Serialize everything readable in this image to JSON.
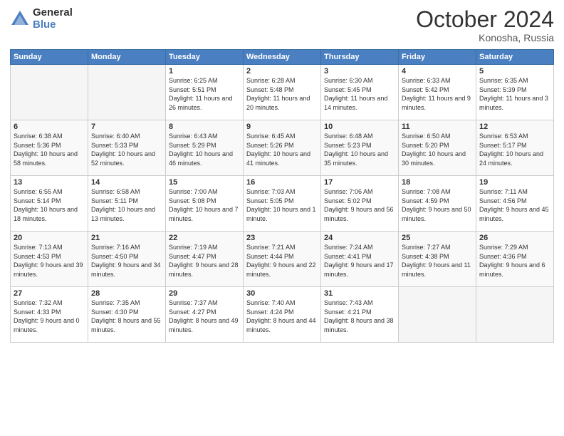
{
  "header": {
    "logo_general": "General",
    "logo_blue": "Blue",
    "month": "October 2024",
    "location": "Konosha, Russia"
  },
  "days_of_week": [
    "Sunday",
    "Monday",
    "Tuesday",
    "Wednesday",
    "Thursday",
    "Friday",
    "Saturday"
  ],
  "weeks": [
    [
      {
        "day": "",
        "info": ""
      },
      {
        "day": "",
        "info": ""
      },
      {
        "day": "1",
        "info": "Sunrise: 6:25 AM\nSunset: 5:51 PM\nDaylight: 11 hours and 26 minutes."
      },
      {
        "day": "2",
        "info": "Sunrise: 6:28 AM\nSunset: 5:48 PM\nDaylight: 11 hours and 20 minutes."
      },
      {
        "day": "3",
        "info": "Sunrise: 6:30 AM\nSunset: 5:45 PM\nDaylight: 11 hours and 14 minutes."
      },
      {
        "day": "4",
        "info": "Sunrise: 6:33 AM\nSunset: 5:42 PM\nDaylight: 11 hours and 9 minutes."
      },
      {
        "day": "5",
        "info": "Sunrise: 6:35 AM\nSunset: 5:39 PM\nDaylight: 11 hours and 3 minutes."
      }
    ],
    [
      {
        "day": "6",
        "info": "Sunrise: 6:38 AM\nSunset: 5:36 PM\nDaylight: 10 hours and 58 minutes."
      },
      {
        "day": "7",
        "info": "Sunrise: 6:40 AM\nSunset: 5:33 PM\nDaylight: 10 hours and 52 minutes."
      },
      {
        "day": "8",
        "info": "Sunrise: 6:43 AM\nSunset: 5:29 PM\nDaylight: 10 hours and 46 minutes."
      },
      {
        "day": "9",
        "info": "Sunrise: 6:45 AM\nSunset: 5:26 PM\nDaylight: 10 hours and 41 minutes."
      },
      {
        "day": "10",
        "info": "Sunrise: 6:48 AM\nSunset: 5:23 PM\nDaylight: 10 hours and 35 minutes."
      },
      {
        "day": "11",
        "info": "Sunrise: 6:50 AM\nSunset: 5:20 PM\nDaylight: 10 hours and 30 minutes."
      },
      {
        "day": "12",
        "info": "Sunrise: 6:53 AM\nSunset: 5:17 PM\nDaylight: 10 hours and 24 minutes."
      }
    ],
    [
      {
        "day": "13",
        "info": "Sunrise: 6:55 AM\nSunset: 5:14 PM\nDaylight: 10 hours and 18 minutes."
      },
      {
        "day": "14",
        "info": "Sunrise: 6:58 AM\nSunset: 5:11 PM\nDaylight: 10 hours and 13 minutes."
      },
      {
        "day": "15",
        "info": "Sunrise: 7:00 AM\nSunset: 5:08 PM\nDaylight: 10 hours and 7 minutes."
      },
      {
        "day": "16",
        "info": "Sunrise: 7:03 AM\nSunset: 5:05 PM\nDaylight: 10 hours and 1 minute."
      },
      {
        "day": "17",
        "info": "Sunrise: 7:06 AM\nSunset: 5:02 PM\nDaylight: 9 hours and 56 minutes."
      },
      {
        "day": "18",
        "info": "Sunrise: 7:08 AM\nSunset: 4:59 PM\nDaylight: 9 hours and 50 minutes."
      },
      {
        "day": "19",
        "info": "Sunrise: 7:11 AM\nSunset: 4:56 PM\nDaylight: 9 hours and 45 minutes."
      }
    ],
    [
      {
        "day": "20",
        "info": "Sunrise: 7:13 AM\nSunset: 4:53 PM\nDaylight: 9 hours and 39 minutes."
      },
      {
        "day": "21",
        "info": "Sunrise: 7:16 AM\nSunset: 4:50 PM\nDaylight: 9 hours and 34 minutes."
      },
      {
        "day": "22",
        "info": "Sunrise: 7:19 AM\nSunset: 4:47 PM\nDaylight: 9 hours and 28 minutes."
      },
      {
        "day": "23",
        "info": "Sunrise: 7:21 AM\nSunset: 4:44 PM\nDaylight: 9 hours and 22 minutes."
      },
      {
        "day": "24",
        "info": "Sunrise: 7:24 AM\nSunset: 4:41 PM\nDaylight: 9 hours and 17 minutes."
      },
      {
        "day": "25",
        "info": "Sunrise: 7:27 AM\nSunset: 4:38 PM\nDaylight: 9 hours and 11 minutes."
      },
      {
        "day": "26",
        "info": "Sunrise: 7:29 AM\nSunset: 4:36 PM\nDaylight: 9 hours and 6 minutes."
      }
    ],
    [
      {
        "day": "27",
        "info": "Sunrise: 7:32 AM\nSunset: 4:33 PM\nDaylight: 9 hours and 0 minutes."
      },
      {
        "day": "28",
        "info": "Sunrise: 7:35 AM\nSunset: 4:30 PM\nDaylight: 8 hours and 55 minutes."
      },
      {
        "day": "29",
        "info": "Sunrise: 7:37 AM\nSunset: 4:27 PM\nDaylight: 8 hours and 49 minutes."
      },
      {
        "day": "30",
        "info": "Sunrise: 7:40 AM\nSunset: 4:24 PM\nDaylight: 8 hours and 44 minutes."
      },
      {
        "day": "31",
        "info": "Sunrise: 7:43 AM\nSunset: 4:21 PM\nDaylight: 8 hours and 38 minutes."
      },
      {
        "day": "",
        "info": ""
      },
      {
        "day": "",
        "info": ""
      }
    ]
  ]
}
